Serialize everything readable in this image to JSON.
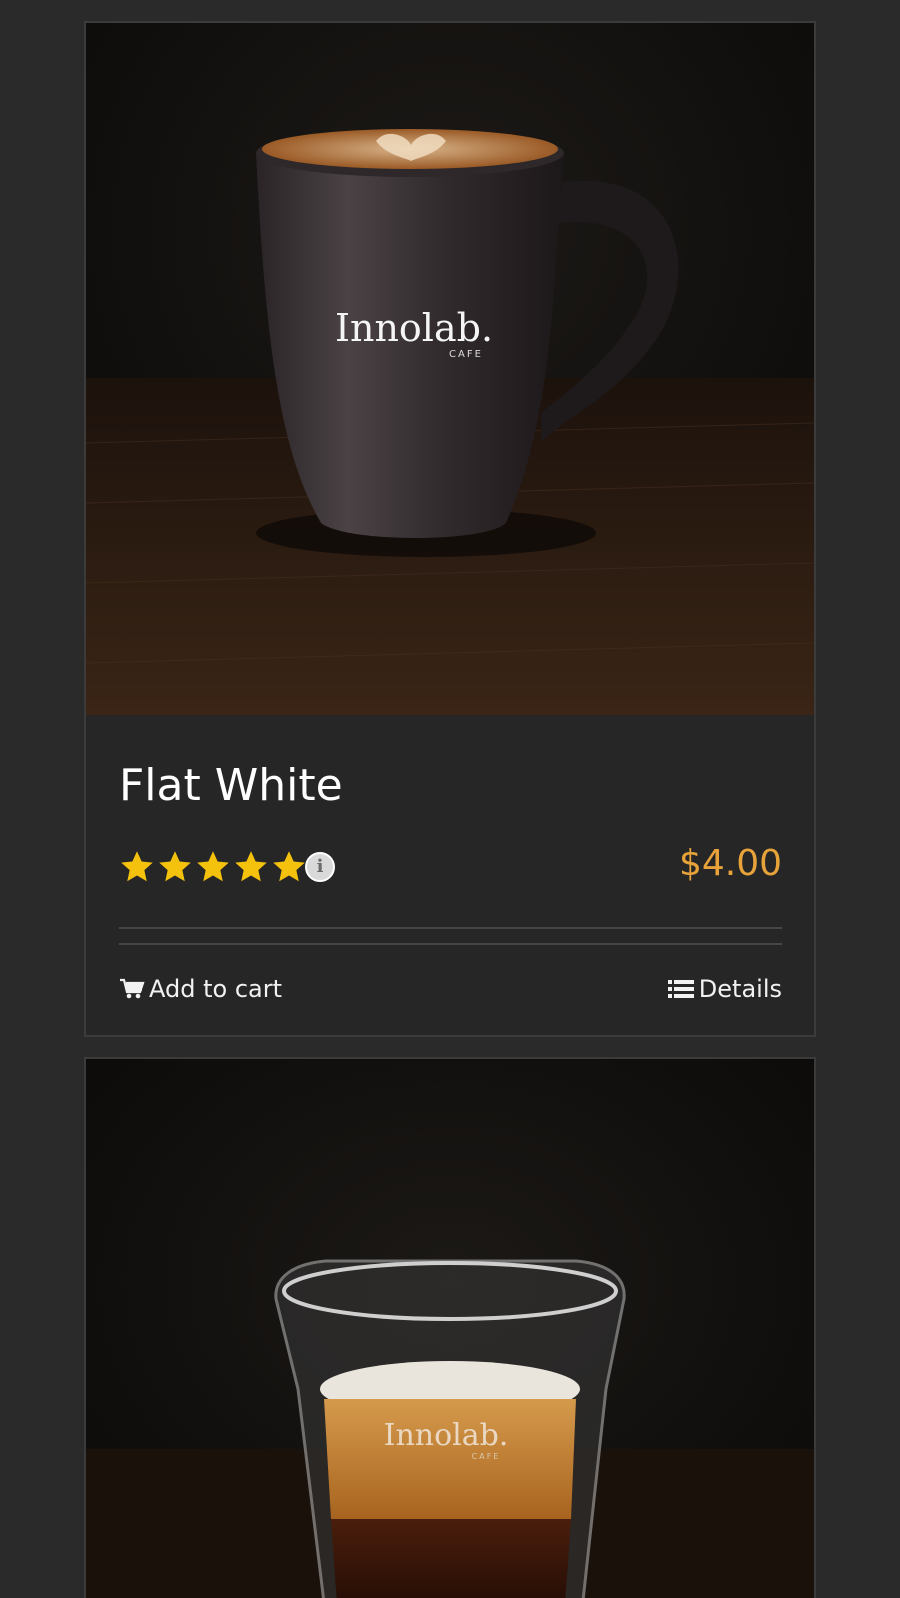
{
  "products": [
    {
      "title": "Flat White",
      "rating": 5,
      "rating_max": 5,
      "info_glyph": "i",
      "price": "$4.00",
      "add_to_cart_label": "Add to cart",
      "details_label": "Details",
      "logo_text": "Innolab.",
      "logo_subtext": "CAFE",
      "image_icon": "coffee-mug-photo"
    },
    {
      "logo_text": "Innolab.",
      "logo_subtext": "CAFE",
      "image_icon": "coffee-glass-photo"
    }
  ],
  "colors": {
    "background": "#2a2a2a",
    "card": "#262626",
    "price": "#e7a33a",
    "star": "#f4c20d"
  },
  "icons": {
    "cart": "cart-icon",
    "details": "list-icon",
    "star": "star-icon",
    "info": "info-icon"
  }
}
